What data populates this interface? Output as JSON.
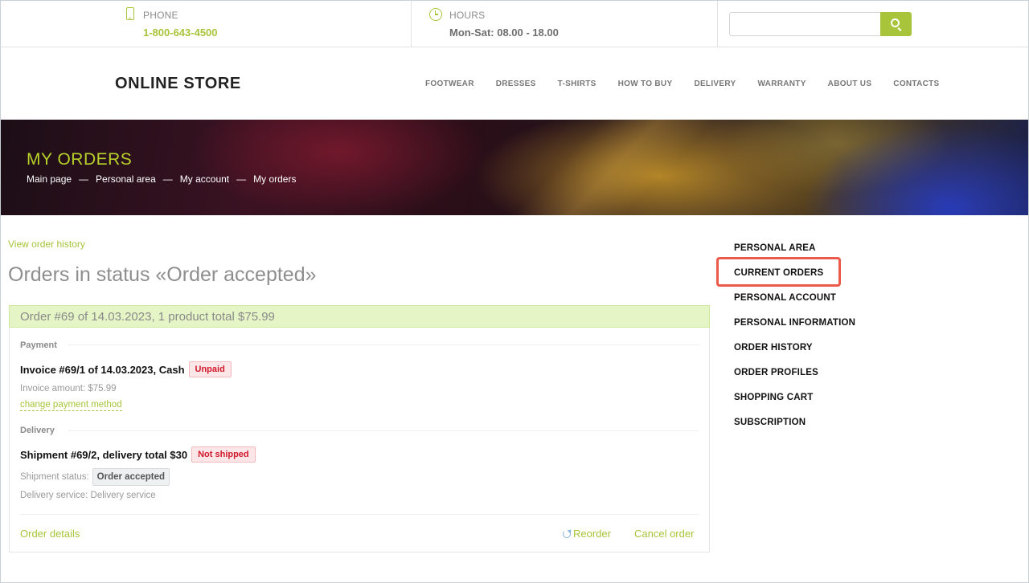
{
  "topbar": {
    "phone_label": "PHONE",
    "phone_value": "1-800-643-4500",
    "hours_label": "HOURS",
    "hours_value": "Mon-Sat: 08.00 - 18.00",
    "search_placeholder": ""
  },
  "header": {
    "logo": "ONLINE STORE",
    "nav": [
      "FOOTWEAR",
      "DRESSES",
      "T-SHIRTS",
      "HOW TO BUY",
      "DELIVERY",
      "WARRANTY",
      "ABOUT US",
      "CONTACTS"
    ]
  },
  "banner": {
    "title": "MY ORDERS",
    "breadcrumb": [
      "Main page",
      "Personal area",
      "My account",
      "My orders"
    ],
    "separator": "—"
  },
  "main": {
    "view_history": "View order history",
    "heading": "Orders in status «Order accepted»",
    "order": {
      "header": "Order #69 of 14.03.2023, 1 product total $75.99",
      "payment_label": "Payment",
      "invoice_title": "Invoice #69/1 of 14.03.2023, Cash",
      "invoice_badge": "Unpaid",
      "invoice_amount": "Invoice amount: $75.99",
      "change_payment": "change payment method",
      "delivery_label": "Delivery",
      "shipment_title": "Shipment #69/2, delivery total $30",
      "shipment_badge": "Not shipped",
      "shipment_status_label": "Shipment status:",
      "shipment_status_value": "Order accepted",
      "delivery_service": "Delivery service: Delivery service",
      "order_details": "Order details",
      "reorder": "Reorder",
      "cancel": "Cancel order"
    }
  },
  "sidebar": {
    "items": [
      "PERSONAL AREA",
      "CURRENT ORDERS",
      "PERSONAL ACCOUNT",
      "PERSONAL INFORMATION",
      "ORDER HISTORY",
      "ORDER PROFILES",
      "SHOPPING CART",
      "SUBSCRIPTION"
    ],
    "highlighted": "CURRENT ORDERS"
  },
  "colors": {
    "accent": "#a7c43a",
    "badge_red": "#d0192b",
    "highlight": "#ec5a4c"
  }
}
